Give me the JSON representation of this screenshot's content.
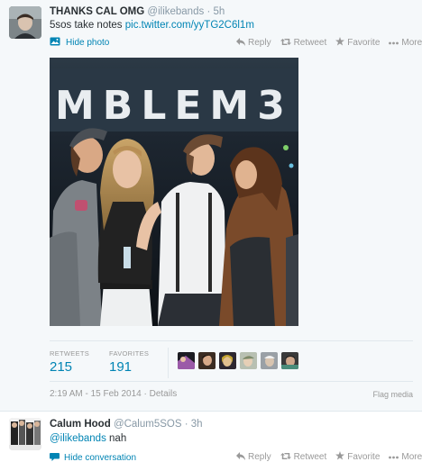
{
  "main_tweet": {
    "fullname": "THANKS CAL OMG",
    "username": "@ilikebands",
    "separator": "·",
    "time": "5h",
    "text_prefix": "5sos take notes ",
    "link": "pic.twitter.com/yyTG2C6l1m",
    "hide_photo": "Hide photo",
    "actions": {
      "reply": "Reply",
      "retweet": "Retweet",
      "favorite": "Favorite",
      "more": "More"
    },
    "photo_banner": "MBLEM3",
    "stats": {
      "retweets_label": "RETWEETS",
      "retweets_value": "215",
      "favorites_label": "FAVORITES",
      "favorites_value": "191"
    },
    "timestamp": "2:19 AM - 15 Feb 2014",
    "details": "Details",
    "flag_media": "Flag media"
  },
  "reply_tweet": {
    "fullname": "Calum Hood",
    "username": "@Calum5SOS",
    "separator": "·",
    "time": "3h",
    "mention": "@ilikebands",
    "text": " nah",
    "hide_conversation": "Hide conversation",
    "actions": {
      "reply": "Reply",
      "retweet": "Retweet",
      "favorite": "Favorite",
      "more": "More"
    }
  },
  "colors": {
    "link": "#0084b4",
    "muted": "#999999",
    "background": "#f5f8fa"
  },
  "icons": [
    "reply-icon",
    "retweet-icon",
    "favorite-icon",
    "more-icon",
    "photo-icon",
    "conversation-icon"
  ]
}
